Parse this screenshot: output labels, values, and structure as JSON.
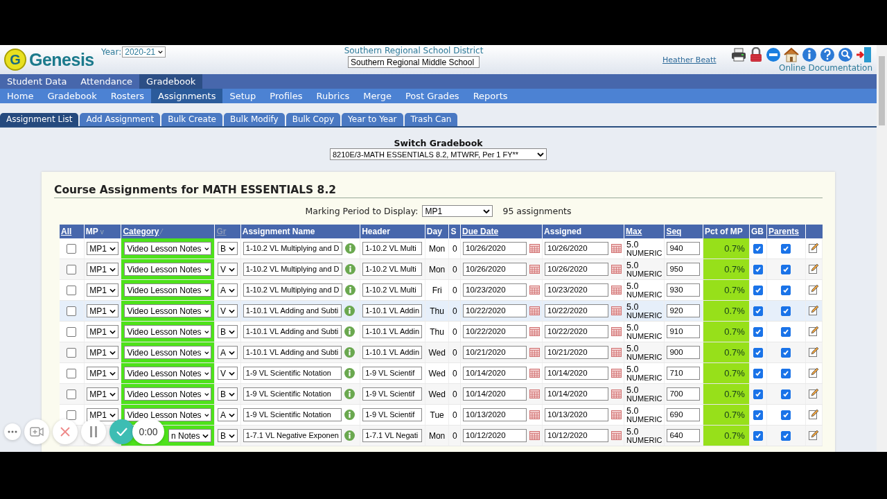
{
  "header": {
    "logo_mark": "G",
    "logo_text": "Genesis",
    "year_label": "Year:",
    "year": "2020-21",
    "district": "Southern Regional School District",
    "school": "Southern Regional Middle School",
    "user": "Heather Beatt",
    "docs": "Online Documentation"
  },
  "main_nav": [
    {
      "label": "Student Data",
      "selected": false
    },
    {
      "label": "Attendance",
      "selected": false
    },
    {
      "label": "Gradebook",
      "selected": true
    }
  ],
  "sub_nav": [
    {
      "label": "Home",
      "selected": false
    },
    {
      "label": "Gradebook",
      "selected": false
    },
    {
      "label": "Rosters",
      "selected": false
    },
    {
      "label": "Assignments",
      "selected": true
    },
    {
      "label": "Setup",
      "selected": false
    },
    {
      "label": "Profiles",
      "selected": false
    },
    {
      "label": "Rubrics",
      "selected": false
    },
    {
      "label": "Merge",
      "selected": false
    },
    {
      "label": "Post Grades",
      "selected": false
    },
    {
      "label": "Reports",
      "selected": false
    }
  ],
  "tabs": [
    {
      "label": "Assignment List",
      "selected": true
    },
    {
      "label": "Add Assignment",
      "selected": false
    },
    {
      "label": "Bulk Create",
      "selected": false
    },
    {
      "label": "Bulk Modify",
      "selected": false
    },
    {
      "label": "Bulk Copy",
      "selected": false
    },
    {
      "label": "Year to Year",
      "selected": false
    },
    {
      "label": "Trash Can",
      "selected": false
    }
  ],
  "switch_gradebook": {
    "label": "Switch Gradebook",
    "value": "8210E/3-MATH ESSENTIALS 8.2, MTWRF, Per 1 FY**"
  },
  "course": {
    "title": "Course Assignments for MATH ESSENTIALS 8.2",
    "marking_period_label": "Marking Period to Display:",
    "marking_period": "MP1",
    "count": "95 assignments"
  },
  "table": {
    "columns": [
      {
        "label": "All",
        "link": true,
        "muted": false
      },
      {
        "label": "MP",
        "link": false,
        "muted": false,
        "sort_mark": "v"
      },
      {
        "label": "Category",
        "link": true,
        "muted": false,
        "sort_mark": "⁄"
      },
      {
        "label": "Gr",
        "link": true,
        "muted": true
      },
      {
        "label": "Assignment Name",
        "link": false,
        "muted": false
      },
      {
        "label": "Header",
        "link": false,
        "muted": false
      },
      {
        "label": "Day",
        "link": false,
        "muted": false
      },
      {
        "label": "S",
        "link": false,
        "muted": false
      },
      {
        "label": "Due Date",
        "link": true,
        "muted": false
      },
      {
        "label": "Assigned",
        "link": false,
        "muted": false
      },
      {
        "label": "Max",
        "link": true,
        "muted": false
      },
      {
        "label": "Seq",
        "link": true,
        "muted": false
      },
      {
        "label": "Pct of MP",
        "link": false,
        "muted": false
      },
      {
        "label": "GB",
        "link": false,
        "muted": false
      },
      {
        "label": "Parents",
        "link": true,
        "muted": false
      }
    ],
    "rows": [
      {
        "selected": false,
        "highlighted": false,
        "mp": "MP1",
        "category": "Video Lesson Notes",
        "gr": "B",
        "name": "1-10.2 VL Multiplying and D",
        "header": "1-10.2 VL Multi",
        "day": "Mon",
        "s": "0",
        "due": "10/26/2020",
        "assigned": "10/26/2020",
        "max": "5.0",
        "max_type": "NUMERIC",
        "seq": "940",
        "pct": "0.7%",
        "gb": true,
        "parents": true
      },
      {
        "selected": false,
        "highlighted": false,
        "mp": "MP1",
        "category": "Video Lesson Notes",
        "gr": "V",
        "name": "1-10.2 VL Multiplying and D",
        "header": "1-10.2 VL Multi",
        "day": "Mon",
        "s": "0",
        "due": "10/26/2020",
        "assigned": "10/26/2020",
        "max": "5.0",
        "max_type": "NUMERIC",
        "seq": "950",
        "pct": "0.7%",
        "gb": true,
        "parents": true
      },
      {
        "selected": false,
        "highlighted": false,
        "mp": "MP1",
        "category": "Video Lesson Notes",
        "gr": "A",
        "name": "1-10.2 VL Multiplying and D",
        "header": "1-10.2 VL Multi",
        "day": "Fri",
        "s": "0",
        "due": "10/23/2020",
        "assigned": "10/23/2020",
        "max": "5.0",
        "max_type": "NUMERIC",
        "seq": "930",
        "pct": "0.7%",
        "gb": true,
        "parents": true
      },
      {
        "selected": false,
        "highlighted": true,
        "mp": "MP1",
        "category": "Video Lesson Notes",
        "gr": "V",
        "name": "1-10.1 VL Adding and Subti",
        "header": "1-10.1 VL Addin",
        "day": "Thu",
        "s": "0",
        "due": "10/22/2020",
        "assigned": "10/22/2020",
        "max": "5.0",
        "max_type": "NUMERIC",
        "seq": "920",
        "pct": "0.7%",
        "gb": true,
        "parents": true
      },
      {
        "selected": false,
        "highlighted": false,
        "mp": "MP1",
        "category": "Video Lesson Notes",
        "gr": "B",
        "name": "1-10.1 VL Adding and Subti",
        "header": "1-10.1 VL Addin",
        "day": "Thu",
        "s": "0",
        "due": "10/22/2020",
        "assigned": "10/22/2020",
        "max": "5.0",
        "max_type": "NUMERIC",
        "seq": "910",
        "pct": "0.7%",
        "gb": true,
        "parents": true
      },
      {
        "selected": false,
        "highlighted": false,
        "mp": "MP1",
        "category": "Video Lesson Notes",
        "gr": "A",
        "name": "1-10.1 VL Adding and Subti",
        "header": "1-10.1 VL Addin",
        "day": "Wed",
        "s": "0",
        "due": "10/21/2020",
        "assigned": "10/21/2020",
        "max": "5.0",
        "max_type": "NUMERIC",
        "seq": "900",
        "pct": "0.7%",
        "gb": true,
        "parents": true
      },
      {
        "selected": false,
        "highlighted": false,
        "mp": "MP1",
        "category": "Video Lesson Notes",
        "gr": "V",
        "name": "1-9 VL Scientific Notation",
        "header": "1-9 VL Scientif",
        "day": "Wed",
        "s": "0",
        "due": "10/14/2020",
        "assigned": "10/14/2020",
        "max": "5.0",
        "max_type": "NUMERIC",
        "seq": "710",
        "pct": "0.7%",
        "gb": true,
        "parents": true
      },
      {
        "selected": false,
        "highlighted": false,
        "mp": "MP1",
        "category": "Video Lesson Notes",
        "gr": "B",
        "name": "1-9 VL Scientific Notation",
        "header": "1-9 VL Scientif",
        "day": "Wed",
        "s": "0",
        "due": "10/14/2020",
        "assigned": "10/14/2020",
        "max": "5.0",
        "max_type": "NUMERIC",
        "seq": "700",
        "pct": "0.7%",
        "gb": true,
        "parents": true
      },
      {
        "selected": false,
        "highlighted": false,
        "mp": "MP1",
        "category": "Video Lesson Notes",
        "gr": "A",
        "name": "1-9 VL Scientific Notation",
        "header": "1-9 VL Scientif",
        "day": "Tue",
        "s": "0",
        "due": "10/13/2020",
        "assigned": "10/13/2020",
        "max": "5.0",
        "max_type": "NUMERIC",
        "seq": "690",
        "pct": "0.7%",
        "gb": true,
        "parents": true
      },
      {
        "highlighted": false,
        "covered": true,
        "category": "n Notes",
        "gr": "B",
        "name": "1-7.1 VL Negative Exponen",
        "header": "1-7.1 VL Negati",
        "day": "Mon",
        "s": "0",
        "due": "10/12/2020",
        "assigned": "10/12/2020",
        "max": "5.0",
        "max_type": "NUMERIC",
        "seq": "640",
        "pct": "0.7%",
        "gb": true,
        "parents": true
      }
    ]
  },
  "recorder": {
    "timer": "0:00"
  }
}
